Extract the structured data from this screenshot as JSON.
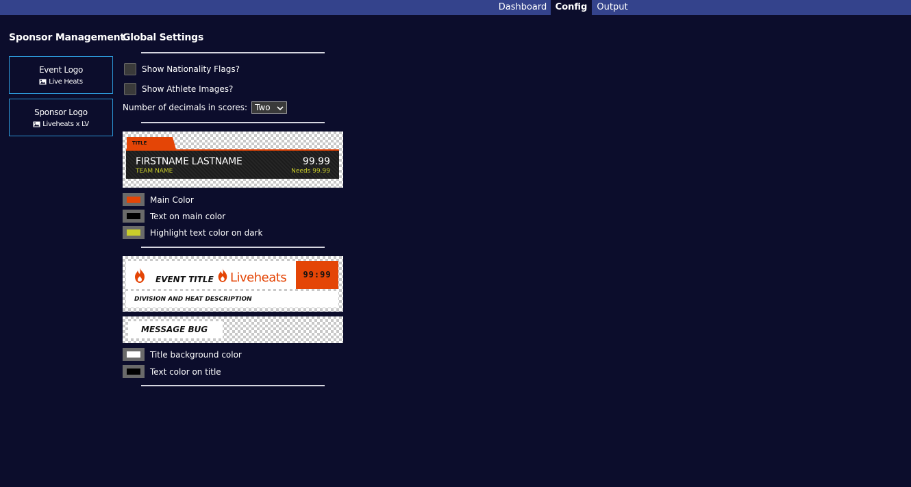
{
  "nav": {
    "tabs": [
      "Dashboard",
      "Config",
      "Output"
    ],
    "active": "Config"
  },
  "sponsor": {
    "heading": "Sponsor Management",
    "cards": [
      {
        "name": "Event Logo",
        "file": "Live Heats"
      },
      {
        "name": "Sponsor Logo",
        "file": "Liveheats x LV"
      }
    ]
  },
  "settings": {
    "heading": "Global Settings",
    "flags_label": "Show Nationality Flags?",
    "athlete_images_label": "Show Athlete Images?",
    "decimals_label": "Number of decimals in scores:",
    "decimals_value": "Two"
  },
  "preview_score": {
    "title": "TITLE",
    "name": "FIRSTNAME LASTNAME",
    "team": "TEAM NAME",
    "score": "99.99",
    "needs": "Needs 99.99"
  },
  "score_colors": {
    "main_label": "Main Color",
    "main_color": "#e44506",
    "text_main_label": "Text on main color",
    "text_main_color": "#000000",
    "highlight_label": "Highlight text color on dark",
    "highlight_color": "#c9cd2b"
  },
  "preview_event": {
    "event_title": "EVENT TITLE",
    "brand": "Liveheats",
    "timer": "99:99",
    "description": "DIVISION AND HEAT DESCRIPTION"
  },
  "preview_message": {
    "text": "MESSAGE BUG"
  },
  "title_colors": {
    "bg_label": "Title background color",
    "bg_color": "#ffffff",
    "text_label": "Text color on title",
    "text_color": "#000000"
  }
}
